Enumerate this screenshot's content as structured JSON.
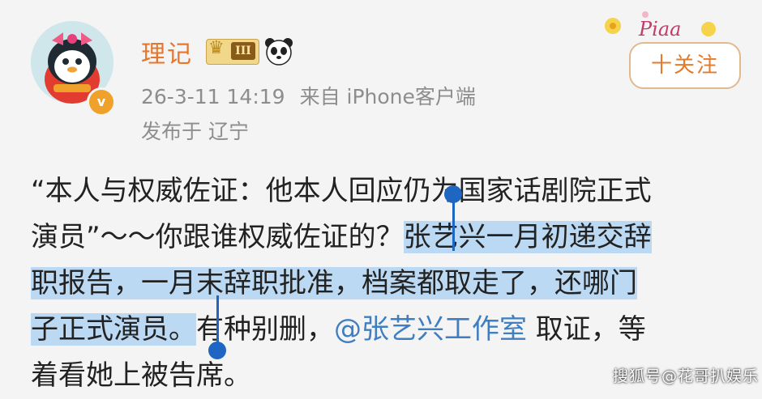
{
  "profile": {
    "username": "理记",
    "member_level": "III",
    "timestamp": "26-3-11 14:19",
    "source": "来自 iPhone客户端",
    "location": "发布于 辽宁",
    "follow_label": "十关注",
    "decor_text": "Piaa"
  },
  "post": {
    "line1": "“本人与权威佐证：他本人回应仍为国家话剧院正式",
    "line2_plain": "演员”～～你跟谁权威佐证的？",
    "line2_selected": "张艺兴一月初递交辞",
    "line3_selected": "职报告，一月末辞职批准，档案都取走了，还哪门",
    "line4_selected": "子正式演员。",
    "line4_plain_a": "有种别删，",
    "line4_mention": "@张艺兴工作室",
    "line4_plain_b": " 取证，等",
    "line5": "着看她上被告席。"
  },
  "watermark": "搜狐号@花哥扒娱乐",
  "colors": {
    "username": "#e6762c",
    "selection": "#bcd9f4",
    "mention": "#3f7ec0",
    "handle": "#1e66c1"
  }
}
